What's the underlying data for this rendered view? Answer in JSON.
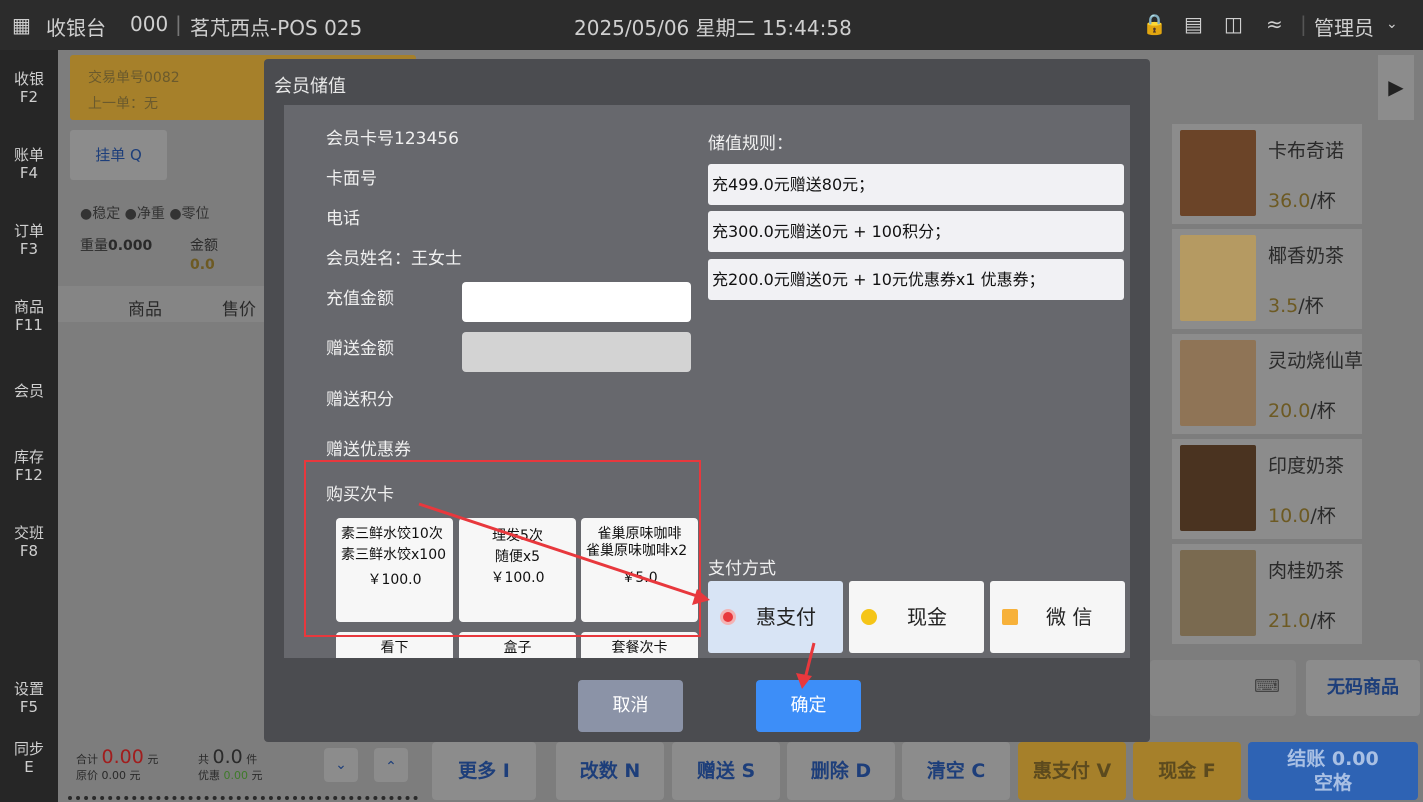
{
  "header": {
    "app_title": "收银台",
    "order_no": "000",
    "store_pos": "茗芃西点-POS 025",
    "datetime": "2025/05/06 星期二 15:44:58",
    "user": "管理员"
  },
  "sidebar": [
    {
      "label": "收银",
      "key": "F2"
    },
    {
      "label": "账单",
      "key": "F4"
    },
    {
      "label": "订单",
      "key": "F3"
    },
    {
      "label": "商品",
      "key": "F11"
    },
    {
      "label": "会员",
      "key": ""
    },
    {
      "label": "库存",
      "key": "F12"
    },
    {
      "label": "交班",
      "key": "F8"
    },
    {
      "label": "设置",
      "key": "F5"
    },
    {
      "label": "同步",
      "key": "E"
    }
  ],
  "left": {
    "trade_no": "交易单号0082",
    "prev": "上一单：无",
    "hold": "挂单 Q",
    "stable": "●稳定",
    "net": "●净重",
    "zero": "●零位",
    "weight_label": "重量",
    "weight": "0.000",
    "amount_label": "金额",
    "amount": "0.0",
    "col_goods": "商品",
    "col_price": "售价",
    "total_label": "合计",
    "total": "0.00",
    "total_unit": "元",
    "orig_label": "原价",
    "orig": "0.00",
    "orig_unit": "元",
    "count_label": "共",
    "count": "0.0",
    "count_unit": "件",
    "disc_label": "优惠",
    "disc": "0.00",
    "disc_unit": "元"
  },
  "products": [
    {
      "name": "卡布奇诺",
      "price": "36.0",
      "unit": "/杯",
      "color": "#6b4428"
    },
    {
      "name": "椰香奶茶",
      "price": "3.5",
      "unit": "/杯",
      "color": "#b59a62"
    },
    {
      "name": "灵动烧仙草",
      "price": "20.0",
      "unit": "/杯",
      "color": "#8f7456"
    },
    {
      "name": "印度奶茶",
      "price": "10.0",
      "unit": "/杯",
      "color": "#4a3320"
    },
    {
      "name": "肉桂奶茶",
      "price": "21.0",
      "unit": "/杯",
      "color": "#7a6a50"
    }
  ],
  "no_code": "无码商品",
  "bottom_buttons": [
    "更多 I",
    "改数 N",
    "赠送 S",
    "删除 D",
    "清空 C",
    "惠支付 V",
    "现金 F"
  ],
  "checkout": {
    "line1": "结账 0.00",
    "line2": "空格"
  },
  "modal": {
    "title": "会员储值",
    "card_no": "会员卡号123456",
    "card_face": "卡面号",
    "phone": "电话",
    "member_name": "会员姓名：王女士",
    "recharge_amount": "充值金额",
    "recharge_value": "",
    "gift_amount": "赠送金额",
    "gift_points": "赠送积分",
    "gift_coupon": "赠送优惠券",
    "rules_title": "储值规则：",
    "rules": [
      "充499.0元赠送80元；",
      "充300.0元赠送0元 + 100积分；",
      "充200.0元赠送0元 + 10元优惠券x1 优惠券；"
    ],
    "buy_card_title": "购买次卡",
    "cards": [
      {
        "l1": "素三鲜水饺10次",
        "l2": "素三鲜水饺x100",
        "price": "￥100.0"
      },
      {
        "l1": "理发5次",
        "l2": "随便x5",
        "price": "￥100.0"
      },
      {
        "l1": "雀巢原味咖啡",
        "l2": "雀巢原味咖啡x2",
        "price": "￥5.0"
      }
    ],
    "cards_row2": [
      "看下",
      "盒子",
      "套餐次卡"
    ],
    "pay_title": "支付方式",
    "pay_methods": [
      "惠支付",
      "现金",
      "微 信"
    ],
    "cancel": "取消",
    "confirm": "确定"
  },
  "colors": {
    "accent_blue": "#3d8ef8",
    "highlight_red": "#e8383d",
    "warn_orange": "#a6802a"
  }
}
